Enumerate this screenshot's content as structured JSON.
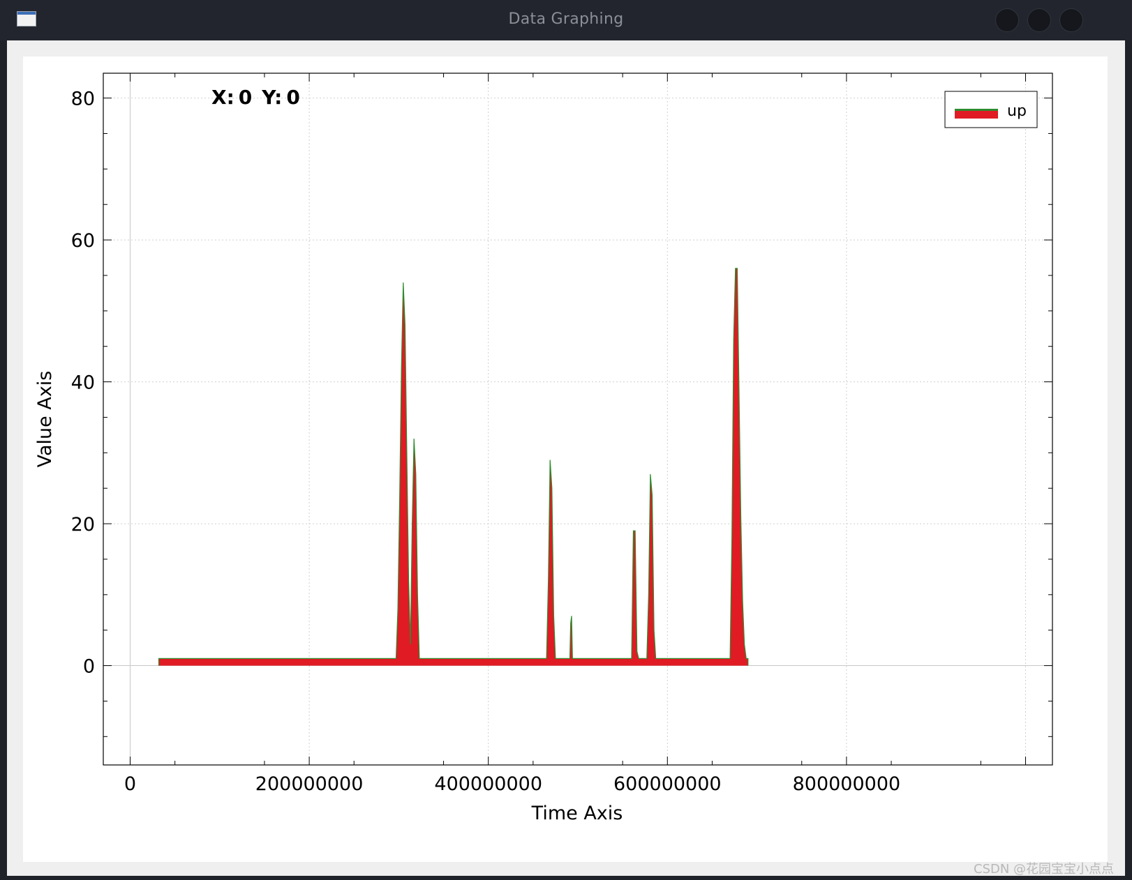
{
  "window": {
    "title": "Data Graphing"
  },
  "readout": {
    "x_label": "X:",
    "x_value": "0",
    "y_label": "Y:",
    "y_value": "0"
  },
  "watermark": "CSDN @花园宝宝小点点",
  "colors": {
    "fill": "#e01b24",
    "stroke": "#2e8b2e",
    "grid": "#c8c8c8"
  },
  "chart_data": {
    "type": "area",
    "xlabel": "Time Axis",
    "ylabel": "Value Axis",
    "xlim": [
      -30000000,
      1030000000
    ],
    "ylim": [
      -14,
      83.5
    ],
    "xticks": [
      0,
      200000000,
      400000000,
      600000000,
      800000000
    ],
    "xtick_labels": [
      "0",
      "200000000",
      "400000000",
      "600000000",
      "800000000"
    ],
    "yticks": [
      0,
      20,
      40,
      60,
      80
    ],
    "ytick_labels": [
      "0",
      "20",
      "40",
      "60",
      "80"
    ],
    "grid": true,
    "legend": "top-right",
    "series": [
      {
        "name": "up",
        "x": [
          32000000,
          32000000,
          297000000,
          299000000,
          301000000,
          303000000,
          305000000,
          307000000,
          309000000,
          311000000,
          313000000,
          315000000,
          317000000,
          319000000,
          321000000,
          323000000,
          325000000,
          327000000,
          329000000,
          331000000,
          333000000,
          335000000,
          465000000,
          467000000,
          469000000,
          471000000,
          473000000,
          475000000,
          477000000,
          479000000,
          491000000,
          492000000,
          493000000,
          494000000,
          560000000,
          562000000,
          564000000,
          566000000,
          568000000,
          570000000,
          577000000,
          579000000,
          581000000,
          583000000,
          585000000,
          587000000,
          590000000,
          670000000,
          672000000,
          674000000,
          676000000,
          678000000,
          680000000,
          682000000,
          684000000,
          686000000,
          688000000,
          690000000,
          690000000
        ],
        "y": [
          0,
          1,
          1,
          8,
          24,
          42,
          54,
          48,
          30,
          12,
          3,
          20,
          32,
          27,
          10,
          1,
          1,
          1,
          1,
          1,
          1,
          1,
          1,
          12,
          29,
          25,
          7,
          1,
          1,
          1,
          1,
          6,
          7,
          1,
          1,
          19,
          19,
          2,
          1,
          1,
          1,
          10,
          27,
          24,
          5,
          1,
          1,
          1,
          18,
          46,
          56,
          56,
          39,
          21,
          9,
          3,
          1,
          1,
          0
        ]
      }
    ]
  }
}
